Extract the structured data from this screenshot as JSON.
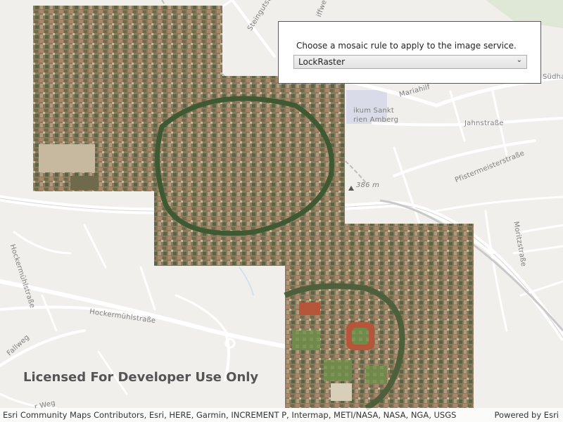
{
  "panel": {
    "prompt": "Choose a mosaic rule to apply to the image service.",
    "selected_rule": "LockRaster"
  },
  "map": {
    "labels": {
      "steinguts": "Steingutstraße",
      "mariahilf": "Mariahilf",
      "klinikum1": "ikum Sankt",
      "klinikum2": "rien Amberg",
      "jahn": "Jahnstraße",
      "pfister": "Pfistermeisterstraße",
      "elevation": "386 m",
      "moritz": "Moritzstraße",
      "hocker_v": "Hockermühlstraße",
      "hocker_h": "Hockermühlstraße",
      "fallweg": "Fallweg",
      "sudha": "Südha",
      "weg": "r Weg",
      "griffwe": "iffwe"
    },
    "watermark": "Licensed For Developer Use Only"
  },
  "attribution": {
    "sources": "Esri Community Maps Contributors, Esri, HERE, Garmin, INCREMENT P, Intermap, METI/NASA, NASA, NGA, USGS",
    "powered_by": "Powered by Esri"
  }
}
